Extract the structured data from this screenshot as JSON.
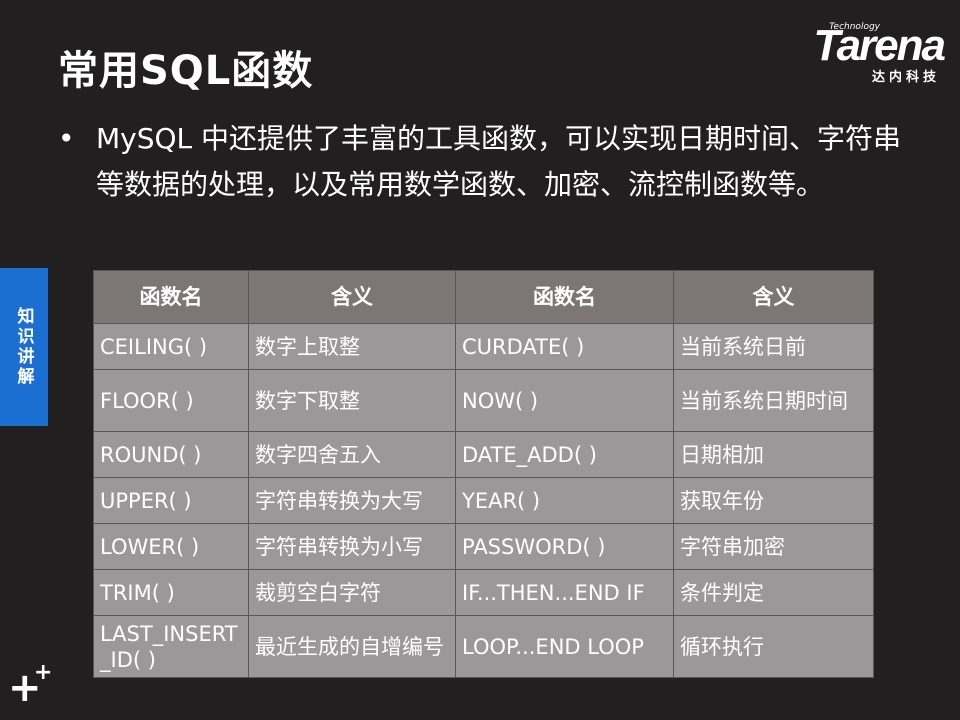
{
  "slide": {
    "title": "常用SQL函数",
    "bullet": "MySQL 中还提供了丰富的工具函数，可以实现日期时间、字符串等数据的处理，以及常用数学函数、加密、流控制函数等。",
    "side_tab": "知识讲解"
  },
  "logo": {
    "tech": "Technology",
    "name": "Tarena",
    "cn": "达内科技"
  },
  "table": {
    "headers": [
      "函数名",
      "含义",
      "函数名",
      "含义"
    ],
    "rows": [
      [
        "CEILING( )",
        "数字上取整",
        "CURDATE( )",
        "当前系统日前"
      ],
      [
        "FLOOR( )",
        "数字下取整",
        "NOW( )",
        "当前系统日期时间"
      ],
      [
        "ROUND( )",
        "数字四舍五入",
        "DATE_ADD( )",
        "日期相加"
      ],
      [
        "UPPER( )",
        "字符串转换为大写",
        "YEAR( )",
        "获取年份"
      ],
      [
        "LOWER( )",
        "字符串转换为小写",
        "PASSWORD( )",
        "字符串加密"
      ],
      [
        "TRIM( )",
        "裁剪空白字符",
        "IF...THEN...END IF",
        "条件判定"
      ],
      [
        "LAST_INSERT_ID( )",
        "最近生成的自增编号",
        "LOOP...END LOOP",
        "循环执行"
      ]
    ]
  },
  "colors": {
    "background": "#221f20",
    "side_tab": "#1c6fd2",
    "table_header": "#7c7677",
    "table_cell": "#9c9899"
  },
  "icons": {
    "corner": "plus-icon"
  }
}
